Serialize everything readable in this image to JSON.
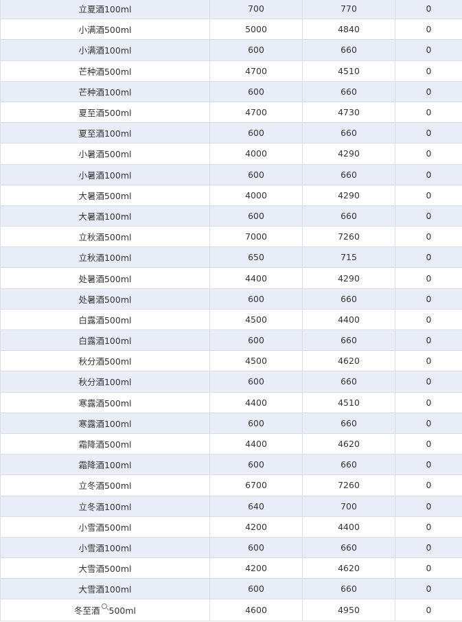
{
  "table": {
    "rows": [
      {
        "name": "立夏酒100ml",
        "v1": "700",
        "v2": "770",
        "v3": "0"
      },
      {
        "name": "小满酒500ml",
        "v1": "5000",
        "v2": "4840",
        "v3": "0"
      },
      {
        "name": "小满酒100ml",
        "v1": "600",
        "v2": "660",
        "v3": "0"
      },
      {
        "name": "芒种酒500ml",
        "v1": "4700",
        "v2": "4510",
        "v3": "0"
      },
      {
        "name": "芒种酒100ml",
        "v1": "600",
        "v2": "660",
        "v3": "0"
      },
      {
        "name": "夏至酒500ml",
        "v1": "4700",
        "v2": "4730",
        "v3": "0"
      },
      {
        "name": "夏至酒100ml",
        "v1": "600",
        "v2": "660",
        "v3": "0"
      },
      {
        "name": "小暑酒500ml",
        "v1": "4000",
        "v2": "4290",
        "v3": "0"
      },
      {
        "name": "小暑酒100ml",
        "v1": "600",
        "v2": "660",
        "v3": "0"
      },
      {
        "name": "大暑酒500ml",
        "v1": "4000",
        "v2": "4290",
        "v3": "0"
      },
      {
        "name": "大暑酒100ml",
        "v1": "600",
        "v2": "660",
        "v3": "0"
      },
      {
        "name": "立秋酒500ml",
        "v1": "7000",
        "v2": "7260",
        "v3": "0"
      },
      {
        "name": "立秋酒100ml",
        "v1": "650",
        "v2": "715",
        "v3": "0"
      },
      {
        "name": "处暑酒500ml",
        "v1": "4400",
        "v2": "4290",
        "v3": "0"
      },
      {
        "name": "处暑酒500ml",
        "v1": "600",
        "v2": "660",
        "v3": "0"
      },
      {
        "name": "白露酒500ml",
        "v1": "4500",
        "v2": "4400",
        "v3": "0"
      },
      {
        "name": "白露酒100ml",
        "v1": "600",
        "v2": "660",
        "v3": "0"
      },
      {
        "name": "秋分酒500ml",
        "v1": "4500",
        "v2": "4620",
        "v3": "0"
      },
      {
        "name": "秋分酒100ml",
        "v1": "600",
        "v2": "660",
        "v3": "0"
      },
      {
        "name": "寒露酒500ml",
        "v1": "4400",
        "v2": "4510",
        "v3": "0"
      },
      {
        "name": "寒露酒100ml",
        "v1": "600",
        "v2": "660",
        "v3": "0"
      },
      {
        "name": "霜降酒500ml",
        "v1": "4400",
        "v2": "4620",
        "v3": "0"
      },
      {
        "name": "霜降酒100ml",
        "v1": "600",
        "v2": "660",
        "v3": "0"
      },
      {
        "name": "立冬酒500ml",
        "v1": "6700",
        "v2": "7260",
        "v3": "0"
      },
      {
        "name": "立冬酒100ml",
        "v1": "640",
        "v2": "700",
        "v3": "0"
      },
      {
        "name": "小雪酒500ml",
        "v1": "4200",
        "v2": "4400",
        "v3": "0"
      },
      {
        "name": "小雪酒100ml",
        "v1": "600",
        "v2": "660",
        "v3": "0"
      },
      {
        "name": "大雪酒500ml",
        "v1": "4200",
        "v2": "4620",
        "v3": "0"
      },
      {
        "name": "大雪酒100ml",
        "v1": "600",
        "v2": "660",
        "v3": "0"
      }
    ],
    "last_row": {
      "name_part1": "冬至酒",
      "name_part2": "500ml",
      "v1": "4600",
      "v2": "4950",
      "v3": "0"
    }
  },
  "icons": {
    "last_row_icon": "search-icon"
  },
  "colors": {
    "row_stripe": "#e8edf7",
    "row_plain": "#ffffff",
    "border": "#d9dde3",
    "text": "#333333"
  }
}
